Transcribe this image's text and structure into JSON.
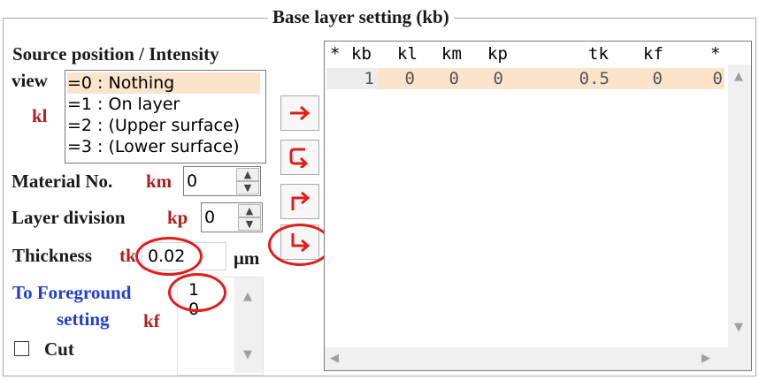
{
  "title": "Base layer setting (kb)",
  "source": {
    "label1": "Source position / Intensity",
    "label2": "view",
    "code": "kl",
    "options": [
      "=0 : Nothing",
      "=1 : On layer",
      "=2 : (Upper surface)",
      "=3 : (Lower surface)"
    ],
    "selected_index": 0
  },
  "material": {
    "label": "Material No.",
    "code": "km",
    "value": "0"
  },
  "layer_division": {
    "label": "Layer division",
    "code": "kp",
    "value": "0"
  },
  "thickness": {
    "label": "Thickness",
    "code": "tk",
    "value": "0.02",
    "unit": "μm"
  },
  "foreground": {
    "label1": "To Foreground",
    "label2": "setting",
    "code": "kf",
    "options": [
      "1",
      "0"
    ]
  },
  "cut": {
    "label": "Cut",
    "checked": false
  },
  "arrows": [
    "right-arrow-icon",
    "loop-return-icon",
    "up-right-arrow-icon",
    "down-right-arrow-icon"
  ],
  "table": {
    "headers": [
      "*",
      "kb",
      "kl",
      "km",
      "kp",
      "tk",
      "kf",
      "*"
    ],
    "rows": [
      [
        "1",
        "0",
        "0",
        "0",
        "0.5",
        "0",
        "0"
      ]
    ]
  },
  "colors": {
    "accent_red": "#b01e1e",
    "accent_blue": "#1f3fd0",
    "highlight_circle": "#e21b1b",
    "row_highlight": "#fbe3cc"
  }
}
